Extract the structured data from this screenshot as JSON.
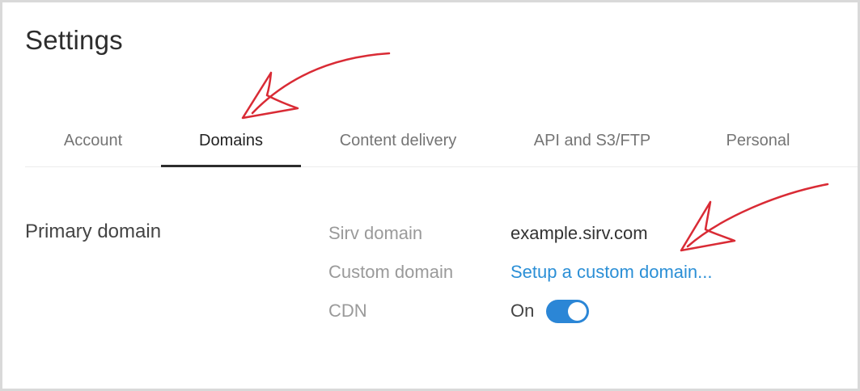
{
  "page": {
    "title": "Settings"
  },
  "tabs": [
    {
      "label": "Account",
      "active": false
    },
    {
      "label": "Domains",
      "active": true
    },
    {
      "label": "Content delivery",
      "active": false
    },
    {
      "label": "API and S3/FTP",
      "active": false
    },
    {
      "label": "Personal",
      "active": false
    }
  ],
  "primary_domain": {
    "section_title": "Primary domain",
    "sirv_domain": {
      "label": "Sirv domain",
      "value": "example.sirv.com"
    },
    "custom_domain": {
      "label": "Custom domain",
      "link_text": "Setup a custom domain..."
    },
    "cdn": {
      "label": "CDN",
      "state": "On",
      "enabled": true
    }
  },
  "colors": {
    "accent": "#2b86d6",
    "link": "#2b8fd6",
    "annotation_arrow": "#d92b35"
  },
  "icons": {
    "annotation": "red-arrow-icon"
  }
}
